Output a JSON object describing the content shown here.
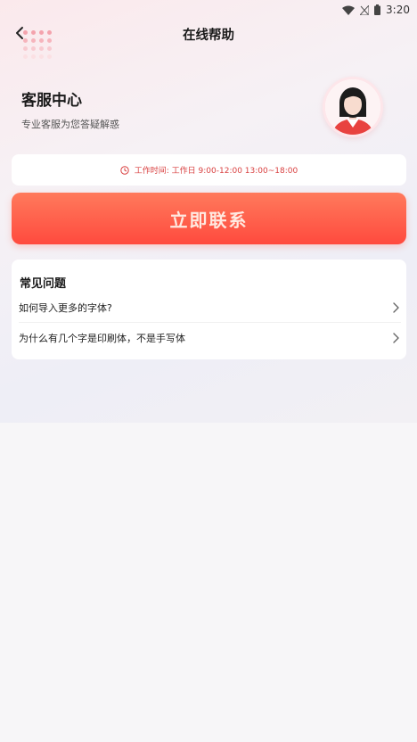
{
  "status_bar": {
    "time": "3:20",
    "icons": [
      "wifi-icon",
      "signal-off-icon",
      "battery-icon"
    ]
  },
  "nav": {
    "title": "在线帮助",
    "back_icon": "chevron-left-icon"
  },
  "header": {
    "title": "客服中心",
    "subtitle": "专业客服为您答疑解惑",
    "avatar_icon": "customer-service-avatar"
  },
  "hours": {
    "text": "工作时间: 工作日  9:00-12:00  13:00~18:00",
    "icon": "clock-icon"
  },
  "contact_button": {
    "label": "立即联系"
  },
  "faq": {
    "title": "常见问题",
    "items": [
      {
        "question": "如何导入更多的字体?",
        "icon": "chevron-right-icon"
      },
      {
        "question": "为什么有几个字是印刷体，不是手写体",
        "icon": "chevron-right-icon"
      }
    ]
  },
  "colors": {
    "accent": "#ff4a3e",
    "accent_light": "#ff7a5c",
    "hours_text": "#d94040"
  }
}
